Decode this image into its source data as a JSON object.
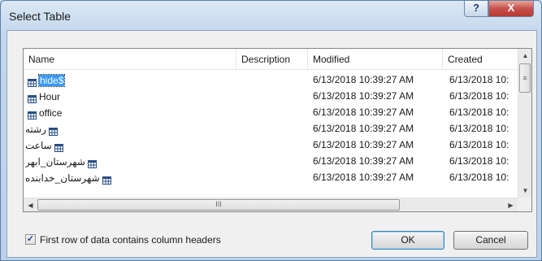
{
  "window": {
    "title": "Select Table",
    "help_label": "?",
    "close_label": "X"
  },
  "columns": {
    "name": "Name",
    "description": "Description",
    "modified": "Modified",
    "created": "Created"
  },
  "rows": [
    {
      "name": "hide$",
      "modified": "6/13/2018 10:39:27 AM",
      "created": "6/13/2018 10:",
      "selected": true,
      "rtl": false
    },
    {
      "name": "Hour",
      "modified": "6/13/2018 10:39:27 AM",
      "created": "6/13/2018 10:",
      "selected": false,
      "rtl": false
    },
    {
      "name": "office",
      "modified": "6/13/2018 10:39:27 AM",
      "created": "6/13/2018 10:",
      "selected": false,
      "rtl": false
    },
    {
      "name": "رشته",
      "modified": "6/13/2018 10:39:27 AM",
      "created": "6/13/2018 10:",
      "selected": false,
      "rtl": true
    },
    {
      "name": "ساعت",
      "modified": "6/13/2018 10:39:27 AM",
      "created": "6/13/2018 10:",
      "selected": false,
      "rtl": true
    },
    {
      "name": "شهرستان_ابهر",
      "modified": "6/13/2018 10:39:27 AM",
      "created": "6/13/2018 10:",
      "selected": false,
      "rtl": true
    },
    {
      "name": "شهرستان_خدابنده",
      "modified": "6/13/2018 10:39:27 AM",
      "created": "6/13/2018 10:",
      "selected": false,
      "rtl": true
    }
  ],
  "scroll": {
    "up": "▲",
    "down": "▼",
    "left": "◀",
    "right": "▶",
    "grip_v": "≡",
    "grip_h": "III"
  },
  "options": {
    "first_row_headers_label": "First row of data contains column headers",
    "first_row_headers_checked": true,
    "check_mark": "✓"
  },
  "buttons": {
    "ok": "OK",
    "cancel": "Cancel"
  }
}
